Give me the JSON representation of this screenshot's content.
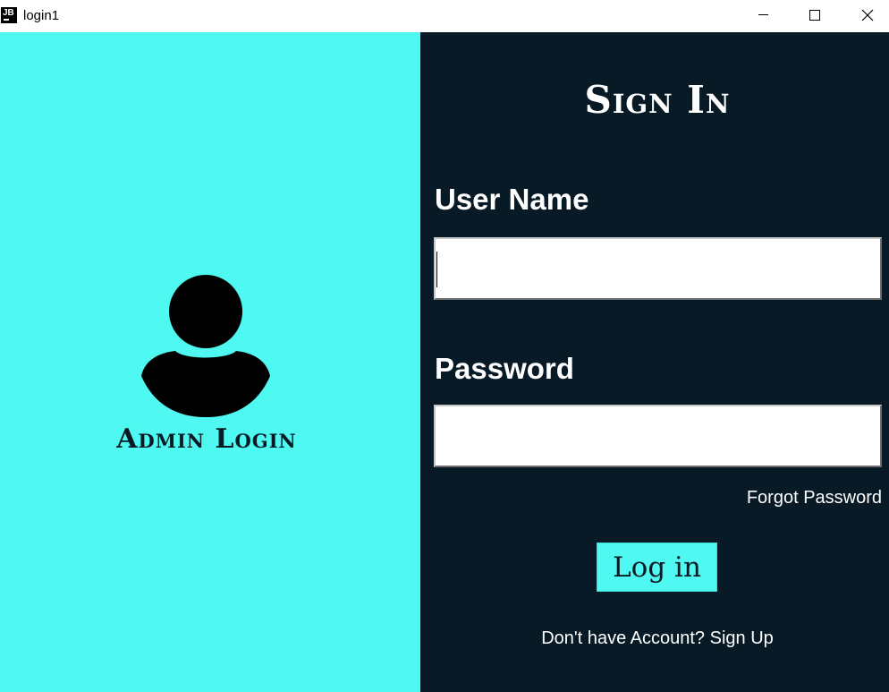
{
  "window": {
    "title": "login1",
    "icon_text": "JB",
    "controls": {
      "minimize": "minimize-icon",
      "maximize": "maximize-icon",
      "close": "close-icon"
    }
  },
  "left_panel": {
    "background": "#4ff8f1",
    "avatar_icon": "user-icon",
    "label": "Admin Login"
  },
  "right_panel": {
    "background": "#071a26",
    "title": "Sign In",
    "username": {
      "label": "User Name",
      "value": ""
    },
    "password": {
      "label": "Password",
      "value": ""
    },
    "forgot_password": "Forgot Password",
    "login_button": "Log in",
    "signup_prompt": "Don't have Account? Sign Up"
  }
}
